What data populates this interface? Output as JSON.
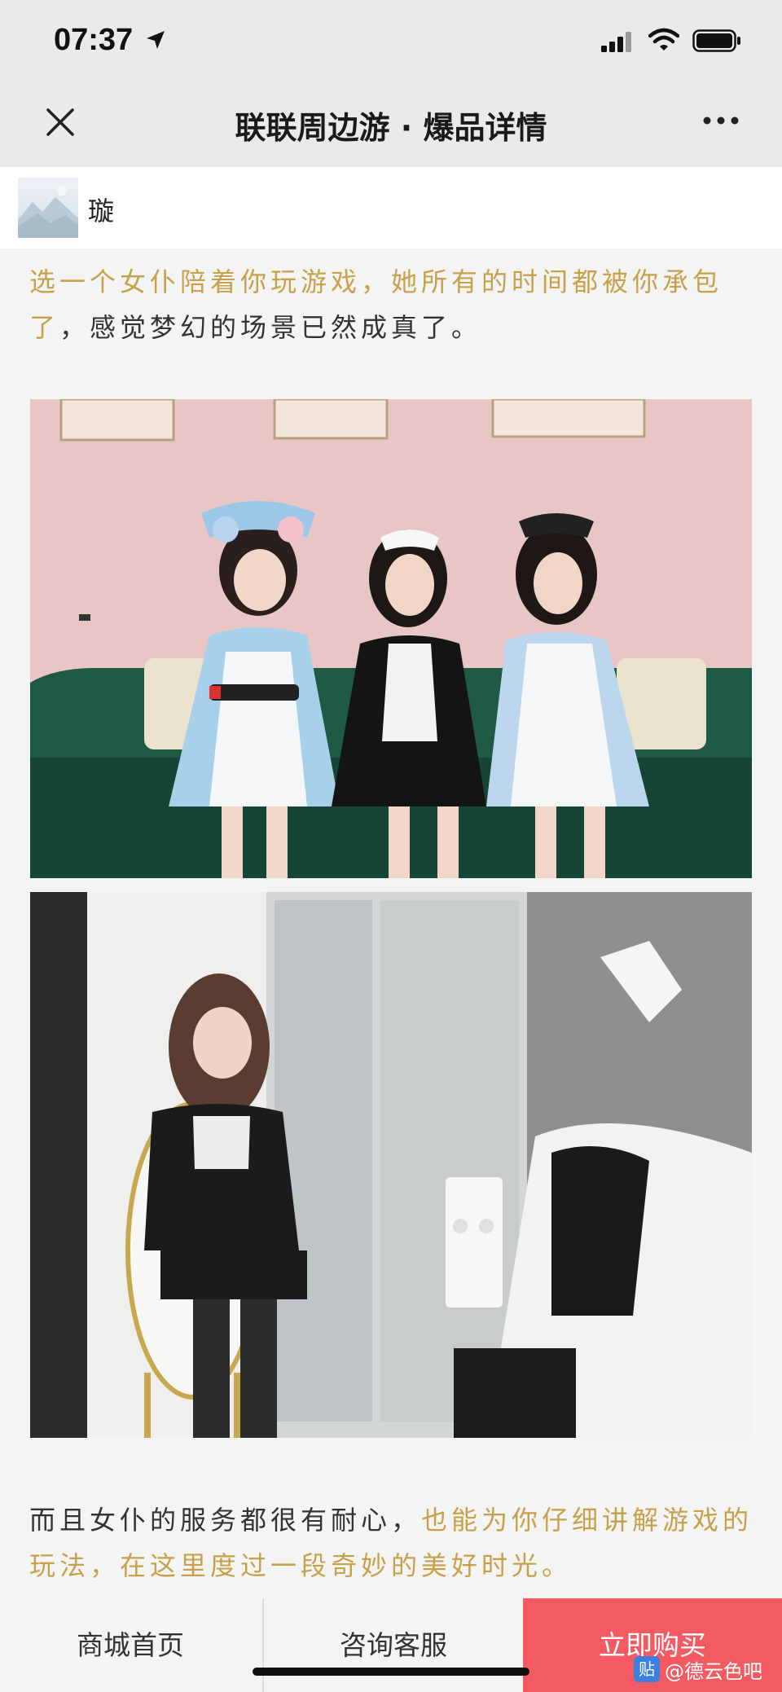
{
  "status_bar": {
    "time": "07:37",
    "icons": [
      "location-arrow-icon",
      "signal-icon",
      "wifi-icon",
      "battery-icon"
    ]
  },
  "header": {
    "title": "联联周边游 · 爆品详情",
    "close_icon": "close-icon",
    "more_icon": "more-icon"
  },
  "account": {
    "name": "璇"
  },
  "article": {
    "para1": {
      "highlight": "选一个女仆陪着你玩游戏，她所有的时间都被你承包了",
      "rest": "，感觉梦幻的场景已然成真了。"
    },
    "para2": {
      "rest": "而且女仆的服务都很有耐心，",
      "highlight": "也能为你仔细讲解游戏的玩法，在这里度过一段奇妙的美好时光。"
    }
  },
  "bottom_bar": {
    "home_label": "商城首页",
    "service_label": "咨询客服",
    "buy_label": "立即购买"
  },
  "watermark": {
    "logo": "贴",
    "text": "@德云色吧"
  },
  "colors": {
    "highlight": "#c9a04a",
    "buy_button": "#f35a62",
    "header_bg": "#e9ebea"
  }
}
